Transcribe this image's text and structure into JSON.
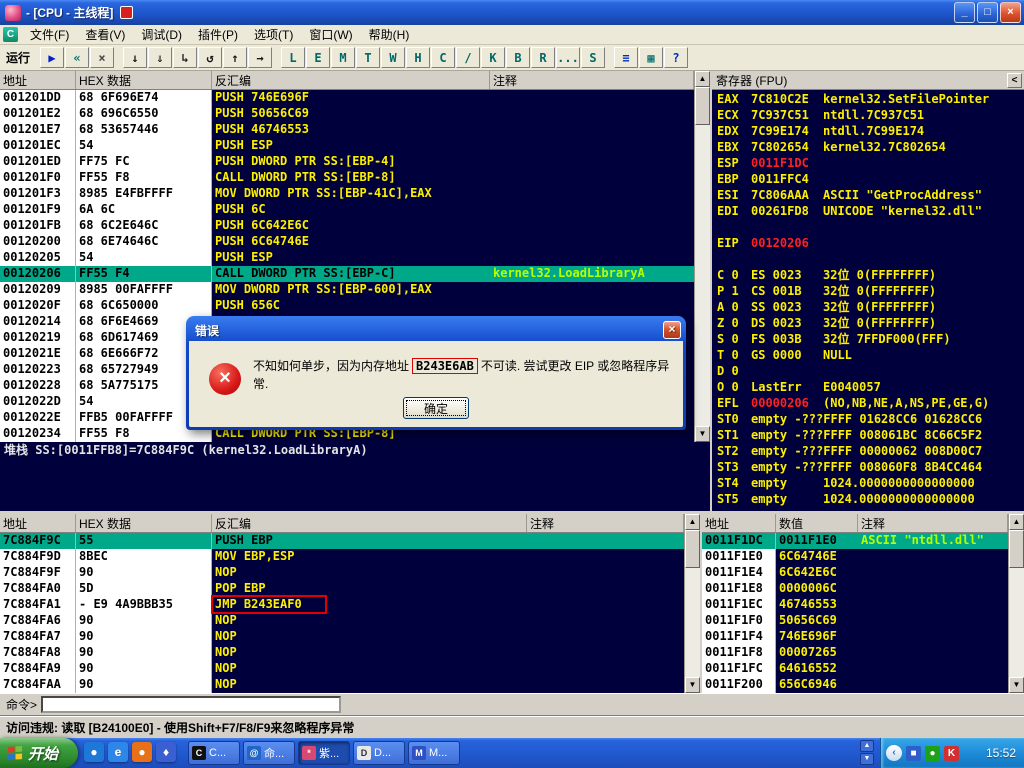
{
  "window": {
    "title": "- [CPU - 主线程]",
    "controls": {
      "minimize": "_",
      "restore": "□",
      "close": "×"
    }
  },
  "menu": {
    "items": [
      "文件(F)",
      "查看(V)",
      "调试(D)",
      "插件(P)",
      "选项(T)",
      "窗口(W)",
      "帮助(H)"
    ]
  },
  "toolbar": {
    "status": "运行",
    "buttons": [
      {
        "glyph": "▶",
        "color": "#0020D0"
      },
      {
        "glyph": "«",
        "color": "#007070"
      },
      {
        "glyph": "×",
        "color": "#484848"
      },
      {
        "glyph": "↓",
        "color": "#181818",
        "gap": true
      },
      {
        "glyph": "⇓",
        "color": "#181818"
      },
      {
        "glyph": "↳",
        "color": "#181818"
      },
      {
        "glyph": "↺",
        "color": "#181818"
      },
      {
        "glyph": "↑",
        "color": "#181818"
      },
      {
        "glyph": "→",
        "color": "#181818"
      },
      {
        "glyph": "L",
        "color": "#006868",
        "gap": true
      },
      {
        "glyph": "E",
        "color": "#006868"
      },
      {
        "glyph": "M",
        "color": "#006868"
      },
      {
        "glyph": "T",
        "color": "#006868"
      },
      {
        "glyph": "W",
        "color": "#006868"
      },
      {
        "glyph": "H",
        "color": "#006868"
      },
      {
        "glyph": "C",
        "color": "#006868"
      },
      {
        "glyph": "/",
        "color": "#006868"
      },
      {
        "glyph": "K",
        "color": "#006868"
      },
      {
        "glyph": "B",
        "color": "#006868"
      },
      {
        "glyph": "R",
        "color": "#006868"
      },
      {
        "glyph": "...",
        "color": "#006868"
      },
      {
        "glyph": "S",
        "color": "#006868"
      },
      {
        "glyph": "≡",
        "color": "#0030C0",
        "gap": true
      },
      {
        "glyph": "▦",
        "color": "#007070"
      },
      {
        "glyph": "?",
        "color": "#0030C0"
      }
    ]
  },
  "panels": {
    "disasm": {
      "headers": [
        "地址",
        "HEX 数据",
        "反汇编",
        "注释"
      ],
      "info": "堆栈 SS:[0011FFB8]=7C884F9C (kernel32.LoadLibraryA)",
      "rows": [
        {
          "addr": "001201DD",
          "hex": "68 6F696E74",
          "asm": "PUSH 746E696F",
          "cmt": ""
        },
        {
          "addr": "001201E2",
          "hex": "68 696C6550",
          "asm": "PUSH 50656C69",
          "cmt": ""
        },
        {
          "addr": "001201E7",
          "hex": "68 53657446",
          "asm": "PUSH 46746553",
          "cmt": ""
        },
        {
          "addr": "001201EC",
          "hex": "54",
          "asm": "PUSH ESP",
          "cmt": ""
        },
        {
          "addr": "001201ED",
          "hex": "FF75 FC",
          "asm": "PUSH DWORD PTR SS:[EBP-4]",
          "cmt": ""
        },
        {
          "addr": "001201F0",
          "hex": "FF55 F8",
          "asm": "CALL DWORD PTR SS:[EBP-8]",
          "cmt": ""
        },
        {
          "addr": "001201F3",
          "hex": "8985 E4FBFFFF",
          "asm": "MOV DWORD PTR SS:[EBP-41C],EAX",
          "cmt": ""
        },
        {
          "addr": "001201F9",
          "hex": "6A 6C",
          "asm": "PUSH 6C",
          "cmt": ""
        },
        {
          "addr": "001201FB",
          "hex": "68 6C2E646C",
          "asm": "PUSH 6C642E6C",
          "cmt": ""
        },
        {
          "addr": "00120200",
          "hex": "68 6E74646C",
          "asm": "PUSH 6C64746E",
          "cmt": ""
        },
        {
          "addr": "00120205",
          "hex": "54",
          "asm": "PUSH ESP",
          "cmt": ""
        },
        {
          "addr": "00120206",
          "hex": "FF55 F4",
          "asm": "CALL DWORD PTR SS:[EBP-C]",
          "cmt": "kernel32.LoadLibraryA",
          "sel": true
        },
        {
          "addr": "00120209",
          "hex": "8985 00FAFFFF",
          "asm": "MOV DWORD PTR SS:[EBP-600],EAX",
          "cmt": ""
        },
        {
          "addr": "0012020F",
          "hex": "68 6C650000",
          "asm": "PUSH 656C",
          "cmt": ""
        },
        {
          "addr": "00120214",
          "hex": "68 6F6E4669",
          "asm": "",
          "cmt": ""
        },
        {
          "addr": "00120219",
          "hex": "68 6D617469",
          "asm": "",
          "cmt": ""
        },
        {
          "addr": "0012021E",
          "hex": "68 6E666F72",
          "asm": "",
          "cmt": ""
        },
        {
          "addr": "00120223",
          "hex": "68 65727949",
          "asm": "",
          "cmt": ""
        },
        {
          "addr": "00120228",
          "hex": "68 5A775175",
          "asm": "",
          "cmt": ""
        },
        {
          "addr": "0012022D",
          "hex": "54",
          "asm": "",
          "cmt": ""
        },
        {
          "addr": "0012022E",
          "hex": "FFB5 00FAFFFF",
          "asm": "",
          "cmt": ""
        },
        {
          "addr": "00120234",
          "hex": "FF55 F8",
          "asm": "CALL DWORD PTR SS:[EBP-8]",
          "cmt": ""
        }
      ]
    },
    "registers": {
      "title": "寄存器 (FPU)",
      "collapse": "<",
      "lines": [
        {
          "label": "EAX",
          "value": "7C810C2E",
          "extra": "kernel32.SetFilePointer"
        },
        {
          "label": "ECX",
          "value": "7C937C51",
          "extra": "ntdll.7C937C51"
        },
        {
          "label": "EDX",
          "value": "7C99E174",
          "extra": "ntdll.7C99E174"
        },
        {
          "label": "EBX",
          "value": "7C802654",
          "extra": "kernel32.7C802654"
        },
        {
          "label": "ESP",
          "value": "0011F1DC",
          "extra": "",
          "red": true
        },
        {
          "label": "EBP",
          "value": "0011FFC4",
          "extra": ""
        },
        {
          "label": "ESI",
          "value": "7C806AAA",
          "extra": "ASCII \"GetProcAddress\""
        },
        {
          "label": "EDI",
          "value": "00261FD8",
          "extra": "UNICODE \"kernel32.dll\""
        },
        {
          "label": "",
          "value": "",
          "extra": ""
        },
        {
          "label": "EIP",
          "value": "00120206",
          "extra": "",
          "red": true
        },
        {
          "label": "",
          "value": "",
          "extra": ""
        },
        {
          "label": "C 0",
          "value": "ES 0023",
          "extra": "32位 0(FFFFFFFF)"
        },
        {
          "label": "P 1",
          "value": "CS 001B",
          "extra": "32位 0(FFFFFFFF)"
        },
        {
          "label": "A 0",
          "value": "SS 0023",
          "extra": "32位 0(FFFFFFFF)"
        },
        {
          "label": "Z 0",
          "value": "DS 0023",
          "extra": "32位 0(FFFFFFFF)"
        },
        {
          "label": "S 0",
          "value": "FS 003B",
          "extra": "32位 7FFDF000(FFF)"
        },
        {
          "label": "T 0",
          "value": "GS 0000",
          "extra": "NULL"
        },
        {
          "label": "D 0",
          "value": "",
          "extra": ""
        },
        {
          "label": "O 0",
          "value": "LastErr",
          "extra": "E0040057"
        },
        {
          "label": "EFL",
          "value": "00000206",
          "extra": "(NO,NB,NE,A,NS,PE,GE,G)",
          "red": true
        },
        {
          "label": "ST0",
          "value": "empty -???",
          "extra": "FFFF 01628CC6 01628CC6"
        },
        {
          "label": "ST1",
          "value": "empty -???",
          "extra": "FFFF 008061BC 8C66C5F2"
        },
        {
          "label": "ST2",
          "value": "empty -???",
          "extra": "FFFF 00000062 008D00C7"
        },
        {
          "label": "ST3",
          "value": "empty -???",
          "extra": "FFFF 008060F8 8B4CC464"
        },
        {
          "label": "ST4",
          "value": "empty",
          "extra": "1024.0000000000000000"
        },
        {
          "label": "ST5",
          "value": "empty",
          "extra": "1024.0000000000000000"
        }
      ]
    },
    "dump": {
      "headers": [
        "地址",
        "HEX 数据",
        "反汇编",
        "注释"
      ],
      "rows": [
        {
          "addr": "7C884F9C",
          "hex": "55",
          "asm": "PUSH EBP",
          "cmt": "",
          "sel": true
        },
        {
          "addr": "7C884F9D",
          "hex": "8BEC",
          "asm": "MOV EBP,ESP",
          "cmt": ""
        },
        {
          "addr": "7C884F9F",
          "hex": "90",
          "asm": "NOP",
          "cmt": ""
        },
        {
          "addr": "7C884FA0",
          "hex": "5D",
          "asm": "POP EBP",
          "cmt": ""
        },
        {
          "addr": "7C884FA1",
          "hex": "- E9 4A9BBB35",
          "asm": "JMP B243EAF0",
          "cmt": "",
          "annot": true
        },
        {
          "addr": "7C884FA6",
          "hex": "90",
          "asm": "NOP",
          "cmt": ""
        },
        {
          "addr": "7C884FA7",
          "hex": "90",
          "asm": "NOP",
          "cmt": ""
        },
        {
          "addr": "7C884FA8",
          "hex": "90",
          "asm": "NOP",
          "cmt": ""
        },
        {
          "addr": "7C884FA9",
          "hex": "90",
          "asm": "NOP",
          "cmt": ""
        },
        {
          "addr": "7C884FAA",
          "hex": "90",
          "asm": "NOP",
          "cmt": ""
        }
      ]
    },
    "stack": {
      "headers": [
        "地址",
        "数值",
        "注释"
      ],
      "rows": [
        {
          "addr": "0011F1DC",
          "value": "0011F1E0",
          "cmt": "ASCII \"ntdll.dll\"",
          "sel": true
        },
        {
          "addr": "0011F1E0",
          "value": "6C64746E",
          "cmt": ""
        },
        {
          "addr": "0011F1E4",
          "value": "6C642E6C",
          "cmt": ""
        },
        {
          "addr": "0011F1E8",
          "value": "0000006C",
          "cmt": ""
        },
        {
          "addr": "0011F1EC",
          "value": "46746553",
          "cmt": ""
        },
        {
          "addr": "0011F1F0",
          "value": "50656C69",
          "cmt": ""
        },
        {
          "addr": "0011F1F4",
          "value": "746E696F",
          "cmt": ""
        },
        {
          "addr": "0011F1F8",
          "value": "00007265",
          "cmt": ""
        },
        {
          "addr": "0011F1FC",
          "value": "64616552",
          "cmt": ""
        },
        {
          "addr": "0011F200",
          "value": "656C6946",
          "cmt": ""
        }
      ]
    }
  },
  "dialog": {
    "title": "错误",
    "message_pre": "不知如何单步，因为内存地址",
    "message_addr": "B243E6AB",
    "message_post": "不可读. 尝试更改 EIP 或忽略程序异常.",
    "ok_label": "确定"
  },
  "command": {
    "label": "命令>",
    "value": ""
  },
  "statusbar": {
    "text": "访问违规: 读取 [B24100E0] - 使用Shift+F7/F8/F9来忽略程序异常"
  },
  "taskbar": {
    "start_label": "开始",
    "quicklaunch": [
      {
        "glyph": "●",
        "bg": "#1E78D8"
      },
      {
        "glyph": "e",
        "bg": "#2E86E8"
      },
      {
        "glyph": "●",
        "bg": "#E87018"
      },
      {
        "glyph": "♦",
        "bg": "#3A5FD0"
      }
    ],
    "tasks": [
      {
        "label": "C...",
        "icon_glyph": "C",
        "icon_bg": "#101010",
        "icon_color": "#FFFFFF"
      },
      {
        "label": "命...",
        "icon_glyph": "@",
        "icon_bg": "#1E66C8",
        "icon_color": "#FFFFFF"
      },
      {
        "label": "紫...",
        "icon_glyph": "*",
        "icon_bg": "#D84870",
        "icon_color": "#FFFFFF",
        "active": true
      },
      {
        "label": "D...",
        "icon_glyph": "D",
        "icon_bg": "#E8E8E8",
        "icon_color": "#303030"
      },
      {
        "label": "M...",
        "icon_glyph": "M",
        "icon_bg": "#2E50C0",
        "icon_color": "#FFFFFF"
      }
    ],
    "tray_icons": [
      {
        "glyph": "■",
        "bg": "#2E5FC8"
      },
      {
        "glyph": "●",
        "bg": "#1EA018"
      },
      {
        "glyph": "K",
        "bg": "#D03030"
      }
    ],
    "time": "15:52"
  }
}
